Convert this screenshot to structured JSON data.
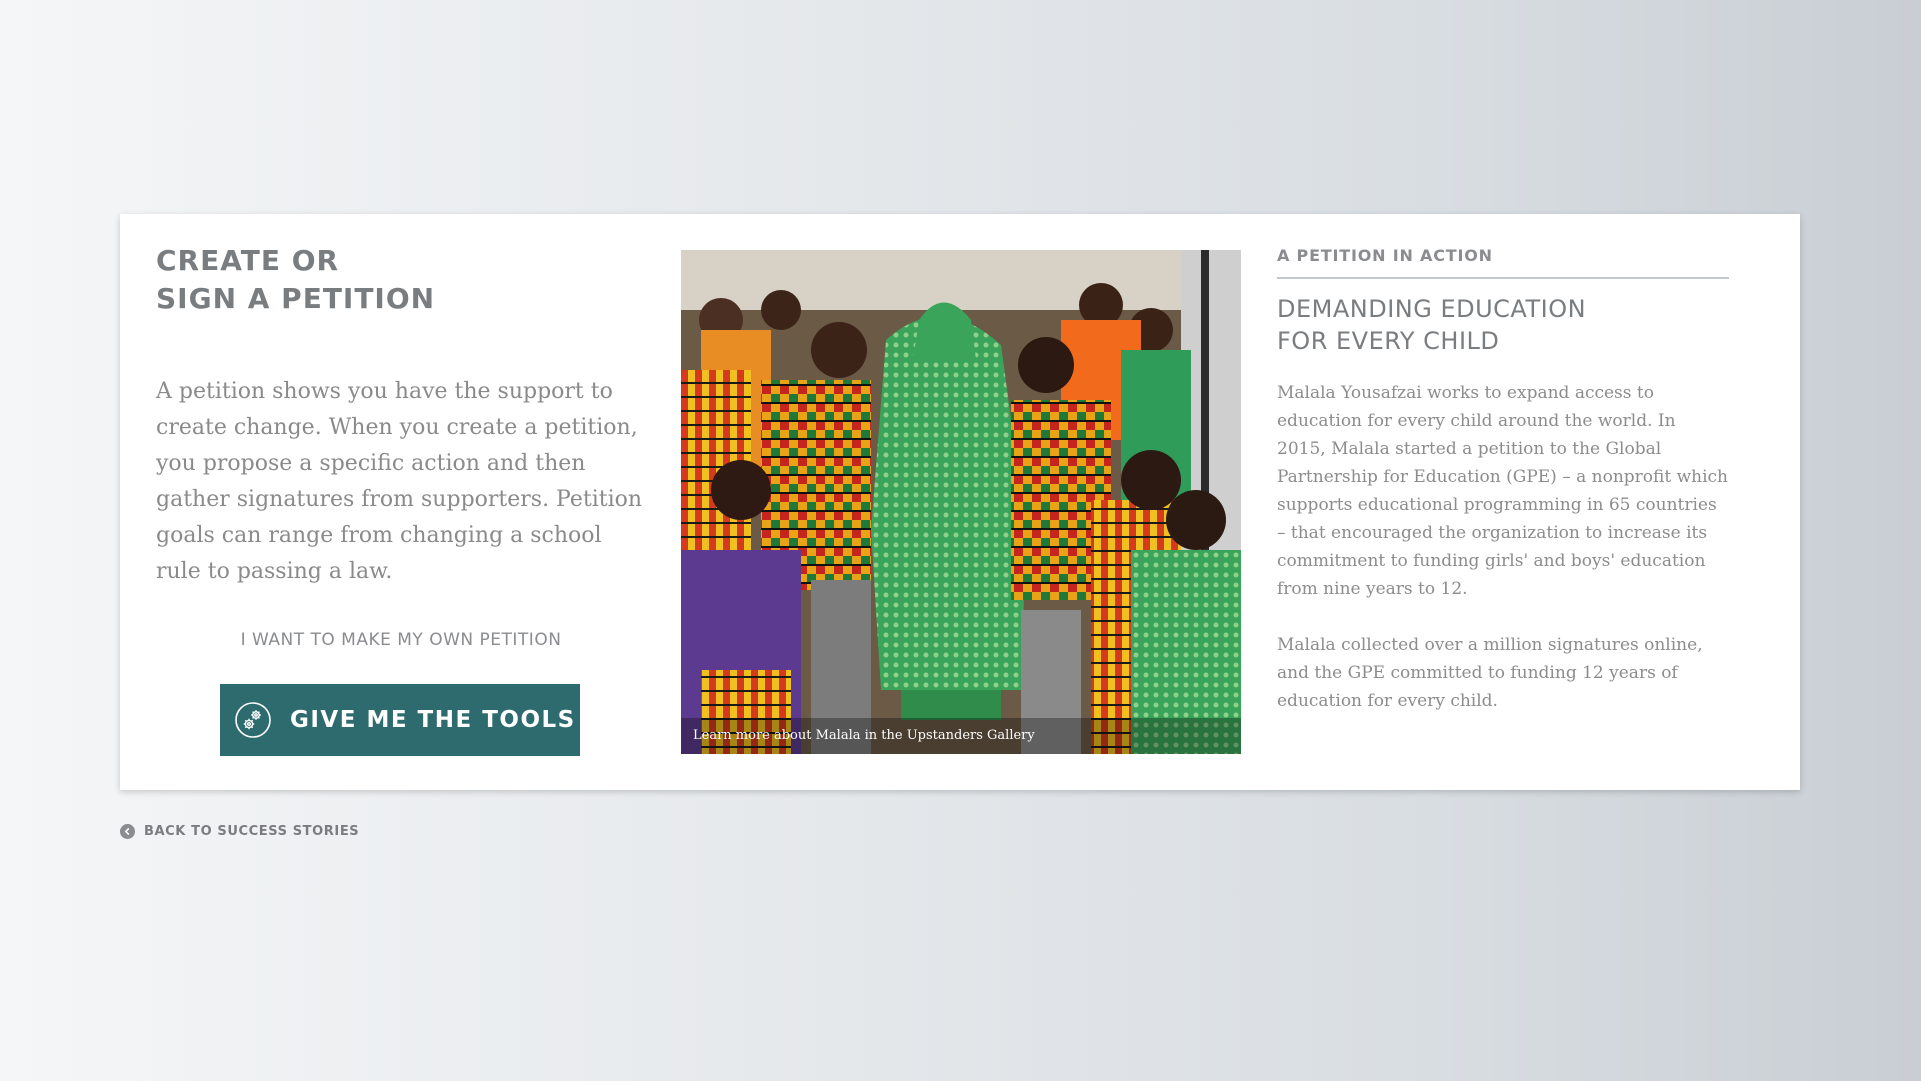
{
  "left": {
    "title_line1": "CREATE OR",
    "title_line2": "SIGN A PETITION",
    "intro": "A petition shows you have the support to create change. When you create a petition, you propose a specific action and then gather signatures from supporters. Petition goals can range from changing a school rule to passing a law.",
    "cta_label": "I WANT TO MAKE MY OWN PETITION",
    "button_label": "GIVE ME THE TOOLS",
    "button_icon": "gear-icon"
  },
  "photo": {
    "caption": "Learn more about Malala in the Upstanders Gallery"
  },
  "right": {
    "eyebrow": "A PETITION IN ACTION",
    "heading_line1": "DEMANDING EDUCATION",
    "heading_line2": "FOR EVERY CHILD",
    "para1": "Malala Yousafzai works to expand access to education for every child around the world. In 2015, Malala started a petition to the Global Partnership for Education (GPE) –  a nonprofit which supports educational programming in 65 countries – that encouraged the organization to increase its commitment to funding girls' and boys' education from nine years to 12.",
    "para2": "Malala collected over a million signatures online, and the GPE committed to funding 12 years of education for every child."
  },
  "back": {
    "label": "BACK TO SUCCESS STORIES",
    "icon": "chevron-left-icon"
  },
  "colors": {
    "button": "#2e6b6f",
    "text_gray": "#8a8c8f",
    "card": "#ffffff"
  }
}
